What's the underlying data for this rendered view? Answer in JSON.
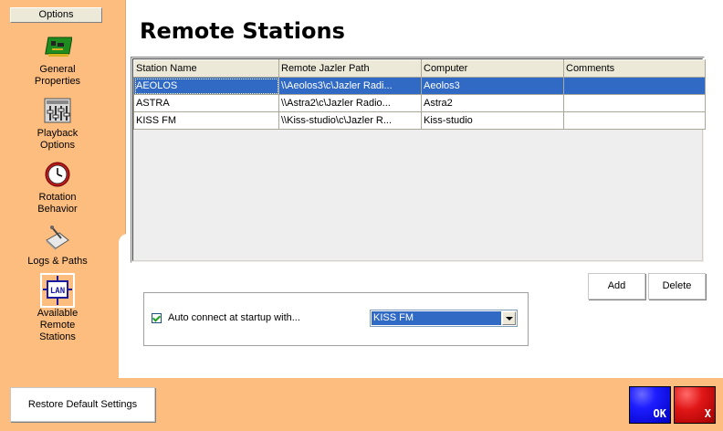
{
  "sidebar": {
    "header": "Options",
    "items": [
      {
        "label_line1": "General",
        "label_line2": "Properties",
        "icon": "circuit-board-icon"
      },
      {
        "label_line1": "Playback",
        "label_line2": "Options",
        "icon": "mixer-sliders-icon"
      },
      {
        "label_line1": "Rotation",
        "label_line2": "Behavior",
        "icon": "clock-icon"
      },
      {
        "label_line1": "Logs & Paths",
        "label_line2": "",
        "icon": "logs-icon"
      },
      {
        "label_line1": "Available",
        "label_line2": "Remote",
        "label_line3": "Stations",
        "icon": "lan-icon"
      }
    ]
  },
  "main": {
    "title": "Remote Stations",
    "columns": [
      "Station Name",
      "Remote Jazler Path",
      "Computer",
      "Comments"
    ],
    "rows": [
      {
        "station": "AEOLOS",
        "path": "\\\\Aeolos3\\c\\Jazler Radi...",
        "computer": "Aeolos3",
        "comments": "",
        "selected": true
      },
      {
        "station": "ASTRA",
        "path": "\\\\Astra2\\c\\Jazler Radio...",
        "computer": "Astra2",
        "comments": "",
        "selected": false
      },
      {
        "station": "KISS FM",
        "path": "\\\\Kiss-studio\\c\\Jazler R...",
        "computer": "Kiss-studio",
        "comments": "",
        "selected": false
      }
    ],
    "add_label": "Add",
    "delete_label": "Delete",
    "auto_connect": {
      "label": "Auto connect at startup with...",
      "checked": true,
      "selected_station": "KISS FM"
    }
  },
  "footer": {
    "restore_label": "Restore Default Settings",
    "ok_label": "OK",
    "cancel_label": "X"
  },
  "colors": {
    "background": "#fcbd7f",
    "selection": "#316ac5",
    "ok": "#1d1dff",
    "cancel": "#e01616"
  }
}
